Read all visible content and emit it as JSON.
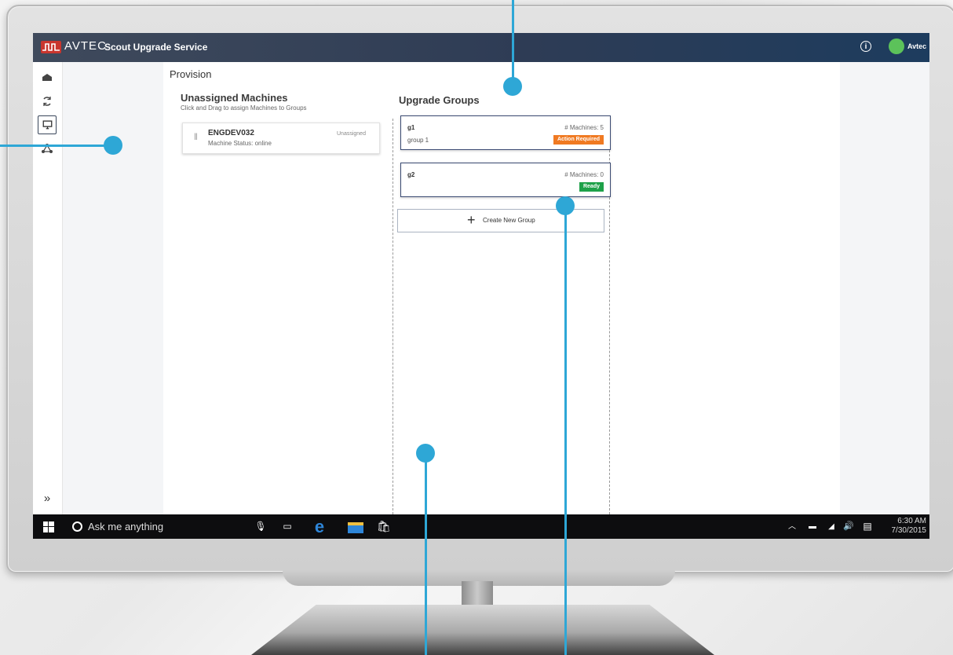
{
  "app": {
    "brand": "AVTEC",
    "title": "Scout Upgrade Service",
    "info_icon": "info-icon",
    "user_name": "Avtec",
    "header_color": "#2e3c55",
    "brand_color": "#c9362e"
  },
  "sidebar": {
    "items": [
      {
        "icon": "home-icon",
        "glyph": "⌂"
      },
      {
        "icon": "refresh-icon",
        "glyph": "⟳"
      },
      {
        "icon": "monitor-icon",
        "glyph": "▭",
        "active": true
      },
      {
        "icon": "network-icon",
        "glyph": "⟁"
      }
    ],
    "expand_glyph": "»"
  },
  "page": {
    "title": "Provision"
  },
  "unassigned": {
    "title": "Unassigned Machines",
    "subtitle": "Click and Drag to assign Machines to Groups",
    "machines": [
      {
        "name": "ENGDEV032",
        "status": "Machine Status: online",
        "state": "Unassigned"
      }
    ]
  },
  "groups": {
    "title": "Upgrade Groups",
    "items": [
      {
        "name": "g1",
        "description": "group 1",
        "count": "# Machines: 5",
        "badge": "Action Required",
        "badge_color": "#f07a22"
      },
      {
        "name": "g2",
        "description": "",
        "count": "# Machines: 0",
        "badge": "Ready",
        "badge_color": "#1ea149"
      }
    ],
    "create_label": "Create New Group"
  },
  "taskbar": {
    "search_placeholder": "Ask me anything",
    "time": "6:30 AM",
    "date": "7/30/2015"
  },
  "callout_color": "#2ea7d6"
}
